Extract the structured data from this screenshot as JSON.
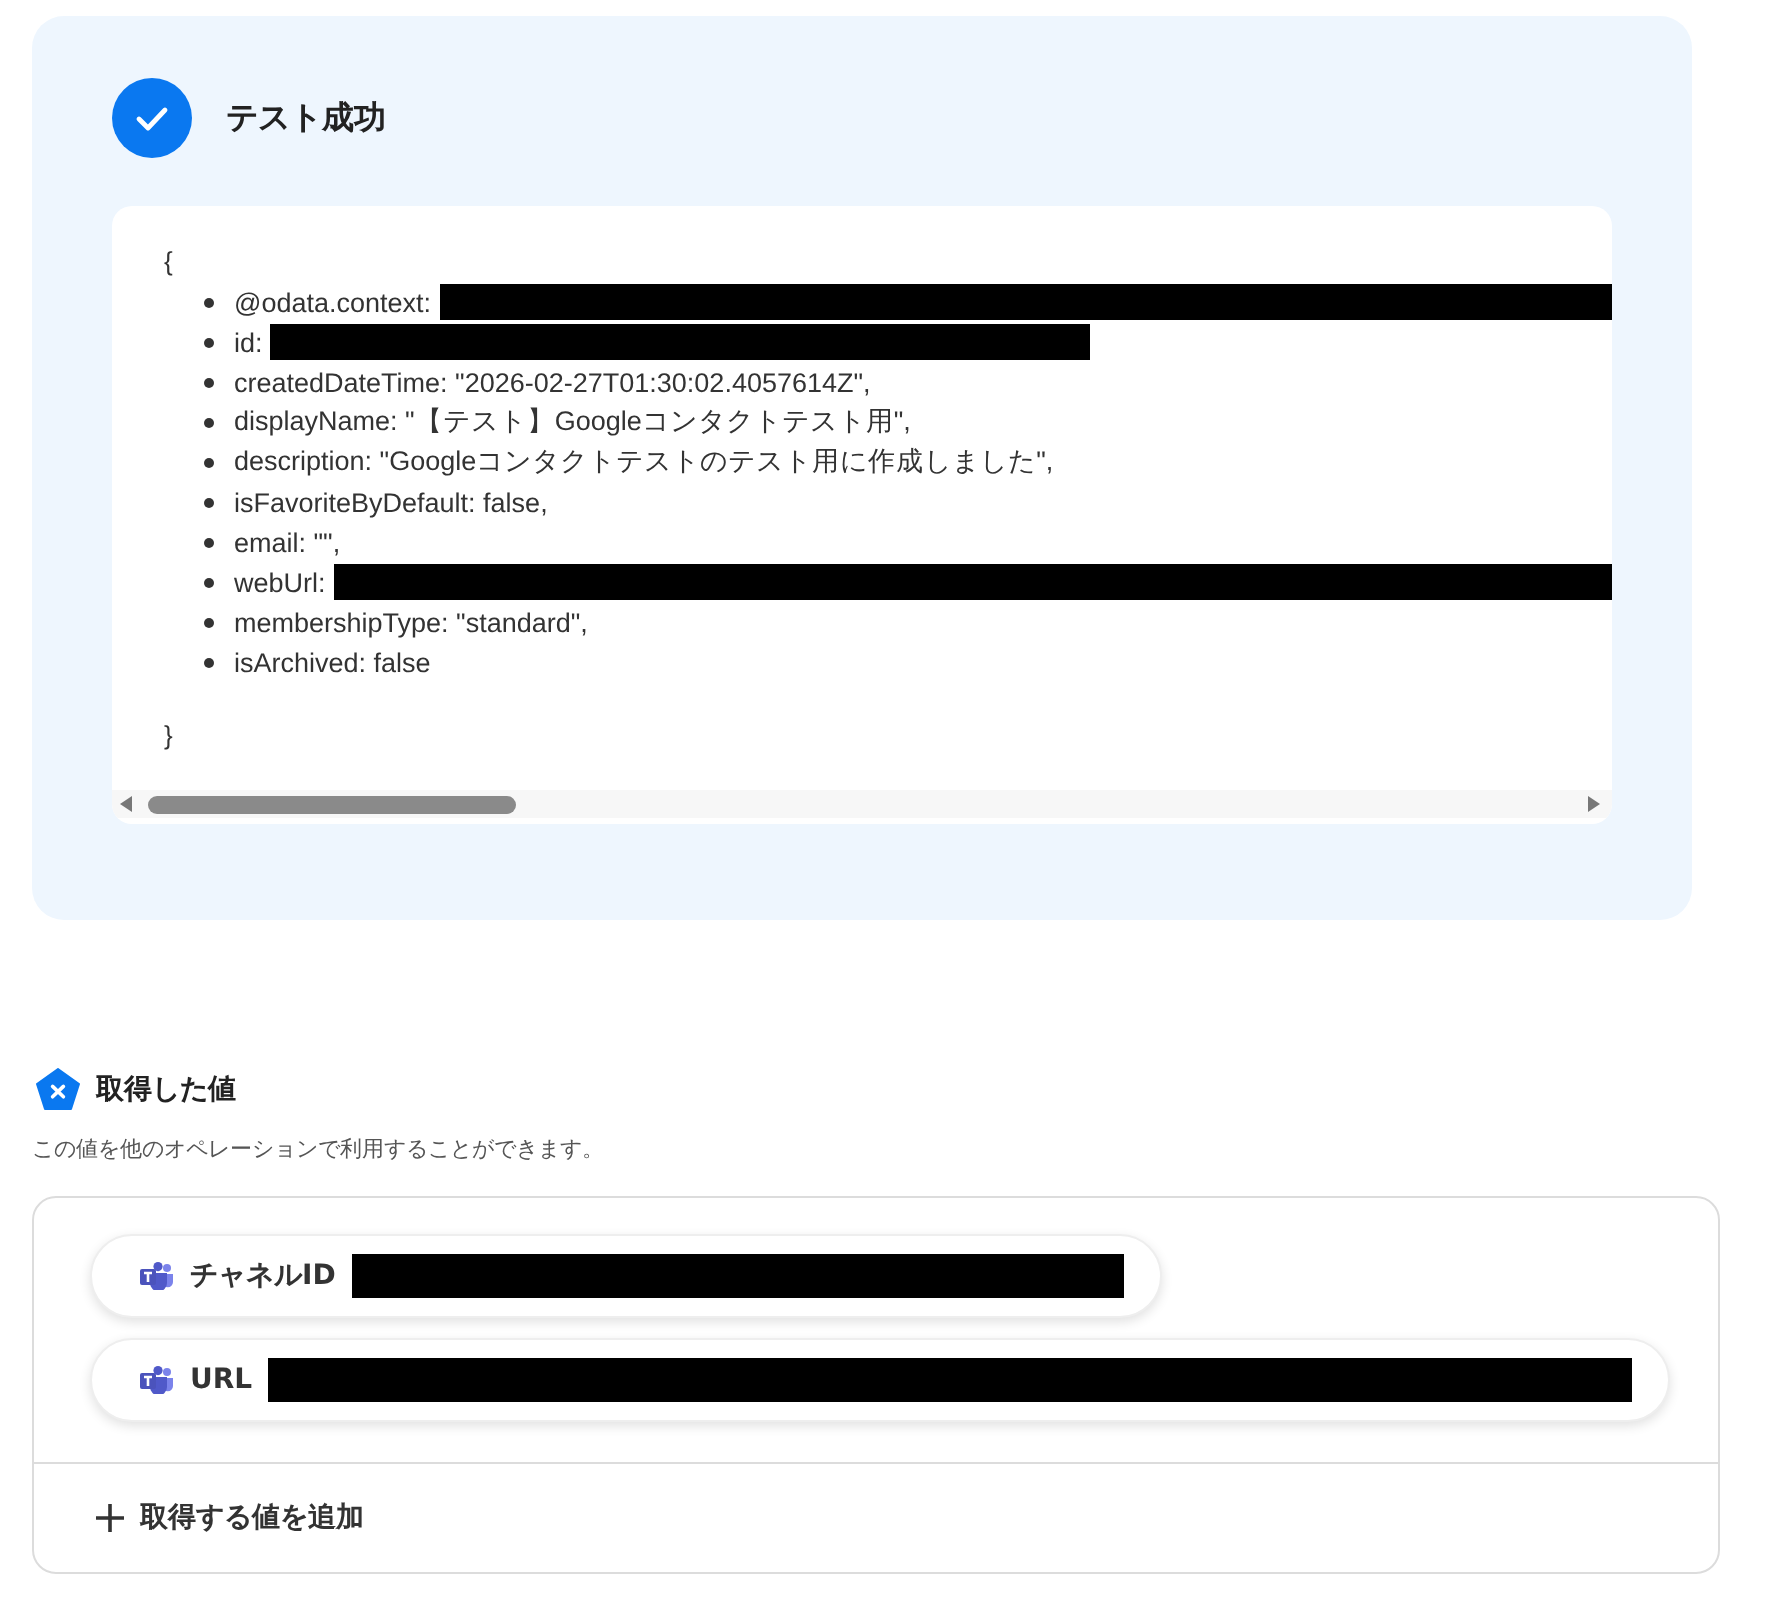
{
  "result": {
    "title": "テスト成功",
    "code": {
      "open": "{",
      "close": "}",
      "items": [
        {
          "key": "@odata.context:",
          "kind": "redacted_overflow"
        },
        {
          "key": "id:",
          "kind": "redacted"
        },
        {
          "key": "createdDateTime:",
          "value": "\"2026-02-27T01:30:02.4057614Z\",",
          "kind": "text"
        },
        {
          "key": "displayName:",
          "value": "\"【テスト】Googleコンタクトテスト用\",",
          "kind": "text"
        },
        {
          "key": "description:",
          "value": "\"Googleコンタクトテストのテスト用に作成しました\",",
          "kind": "text"
        },
        {
          "key": "isFavoriteByDefault:",
          "value": "false,",
          "kind": "text"
        },
        {
          "key": "email:",
          "value": "\"\",",
          "kind": "text"
        },
        {
          "key": "webUrl:",
          "kind": "redacted_overflow"
        },
        {
          "key": "membershipType:",
          "value": "\"standard\",",
          "kind": "text"
        },
        {
          "key": "isArchived:",
          "value": "false",
          "kind": "text"
        }
      ]
    }
  },
  "values": {
    "title": "取得した値",
    "description": "この値を他のオペレーションで利用することができます。",
    "items": [
      {
        "label": "チャネルID"
      },
      {
        "label": "URL"
      }
    ],
    "add_button": "取得する値を追加"
  }
}
